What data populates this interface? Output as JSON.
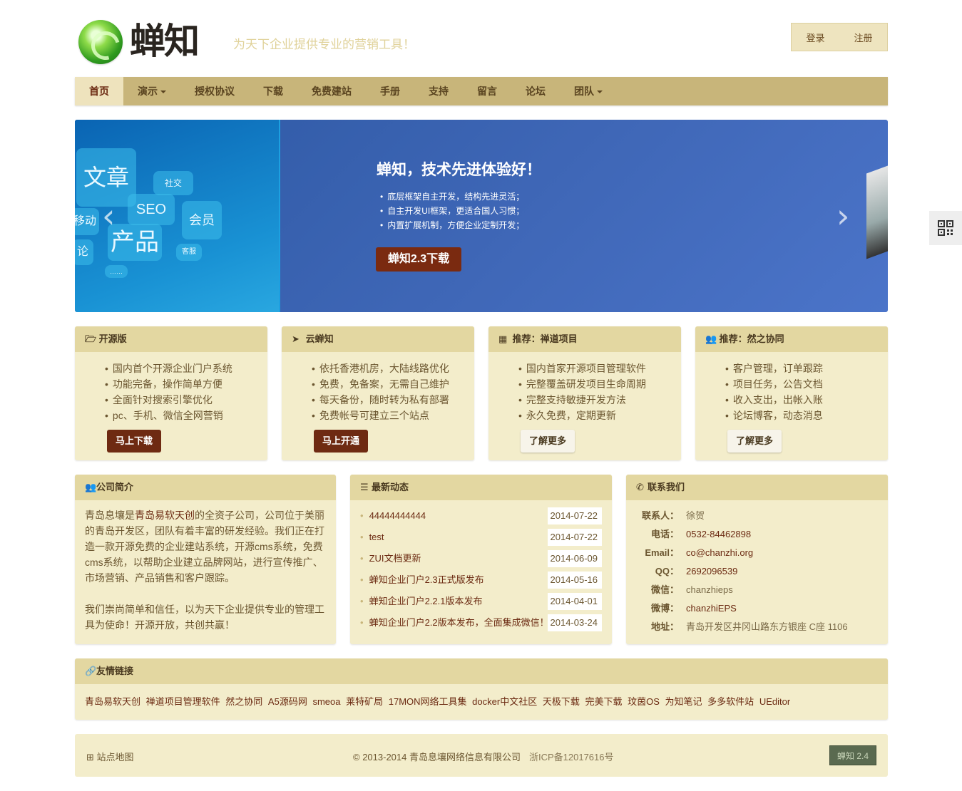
{
  "header": {
    "logo_text": "蝉知",
    "slogan": "为天下企业提供专业的营销工具！",
    "login": "登录",
    "register": "注册"
  },
  "nav": {
    "items": [
      {
        "label": "首页",
        "active": true
      },
      {
        "label": "演示",
        "dropdown": true
      },
      {
        "label": "授权协议"
      },
      {
        "label": "下载"
      },
      {
        "label": "免费建站"
      },
      {
        "label": "手册"
      },
      {
        "label": "支持"
      },
      {
        "label": "留言"
      },
      {
        "label": "论坛"
      },
      {
        "label": "团队",
        "dropdown": true
      }
    ]
  },
  "banner": {
    "tiles": [
      "文章",
      "社交",
      "SEO",
      "移动",
      "会员",
      "产品",
      "客服",
      "论",
      "……"
    ],
    "title": "蝉知，技术先进体验好！",
    "bullets": [
      "底层框架自主开发，结构先进灵活；",
      "自主开发UI框架，更适合国人习惯；",
      "内置扩展机制，方便企业定制开发；"
    ],
    "button": "蝉知2.3下载",
    "prev_icon": "‹",
    "next_icon": "›"
  },
  "features": [
    {
      "title": "开源版",
      "icon": "folder-open-icon",
      "items": [
        "国内首个开源企业门户系统",
        "功能完备，操作简单方便",
        "全面针对搜索引擎优化",
        "pc、手机、微信全网营销"
      ],
      "button": "马上下载",
      "style": "dark"
    },
    {
      "title": "云蝉知",
      "icon": "location-arrow-icon",
      "items": [
        "依托香港机房，大陆线路优化",
        "免费，免备案，无需自己维护",
        "每天备份，随时转为私有部署",
        "免费帐号可建立三个站点"
      ],
      "button": "马上开通",
      "style": "dark"
    },
    {
      "title": "推荐：禅道项目",
      "icon": "grid-icon",
      "items": [
        "国内首家开源项目管理软件",
        "完整覆盖研发项目生命周期",
        "完整支持敏捷开发方法",
        "永久免费，定期更新"
      ],
      "button": "了解更多",
      "style": "light"
    },
    {
      "title": "推荐：然之协同",
      "icon": "group-icon",
      "items": [
        "客户管理，订单跟踪",
        "项目任务，公告文档",
        "收入支出，出帐入账",
        "论坛博客，动态消息"
      ],
      "button": "了解更多",
      "style": "light"
    }
  ],
  "about": {
    "title": "公司简介",
    "p1_pre": "青岛息壤是",
    "p1_link": "青岛易软天创",
    "p1_post": "的全资子公司，公司位于美丽的青岛开发区，团队有着丰富的研发经验。我们正在打造一款开源免费的企业建站系统，开源cms系统，免费cms系统，以帮助企业建立品牌网站，进行宣传推广、市场营销、产品销售和客户跟踪。",
    "p2": "我们崇尚简单和信任，以为天下企业提供专业的管理工具为使命！开源开放，共创共赢！"
  },
  "news": {
    "title": "最新动态",
    "items": [
      {
        "title": "44444444444",
        "date": "2014-07-22"
      },
      {
        "title": "test",
        "date": "2014-07-22"
      },
      {
        "title": "ZUI文档更新",
        "date": "2014-06-09"
      },
      {
        "title": "蝉知企业门户2.3正式版发布",
        "date": "2014-05-16"
      },
      {
        "title": "蝉知企业门户2.2.1版本发布",
        "date": "2014-04-01"
      },
      {
        "title": "蝉知企业门户2.2版本发布，全面集成微信！",
        "date": "2014-03-24"
      }
    ]
  },
  "contact": {
    "title": "联系我们",
    "rows": [
      {
        "k": "联系人：",
        "v": "徐贺",
        "link": false
      },
      {
        "k": "电话：",
        "v": "0532-84462898",
        "link": true
      },
      {
        "k": "Email：",
        "v": "co@chanzhi.org",
        "link": true
      },
      {
        "k": "QQ：",
        "v": "2692096539",
        "link": true
      },
      {
        "k": "微信：",
        "v": "chanzhieps",
        "link": false
      },
      {
        "k": "微博：",
        "v": "chanzhiEPS",
        "link": true
      },
      {
        "k": "地址：",
        "v": "青岛开发区井冈山路东方银座 C座 1106",
        "link": false
      }
    ]
  },
  "friend_links": {
    "title": "友情链接",
    "items": [
      "青岛易软天创",
      "禅道项目管理软件",
      "然之协同",
      "A5源码网",
      "smeoa",
      "莱特矿局",
      "17MON网络工具集",
      "docker中文社区",
      "天极下载",
      "完美下载",
      "玟茵OS",
      "为知笔记",
      "多多软件站",
      "UEditor"
    ]
  },
  "footer": {
    "sitemap": "站点地图",
    "copyright": "© 2013-2014 青岛息壤网络信息有限公司",
    "icp": "浙ICP备12017616号",
    "version": "蝉知 2.4"
  },
  "colors": {
    "accent": "#c8b57a",
    "panel": "#f3edcb",
    "panel_head": "#e3d7a1",
    "button_dark": "#6e2a12"
  }
}
